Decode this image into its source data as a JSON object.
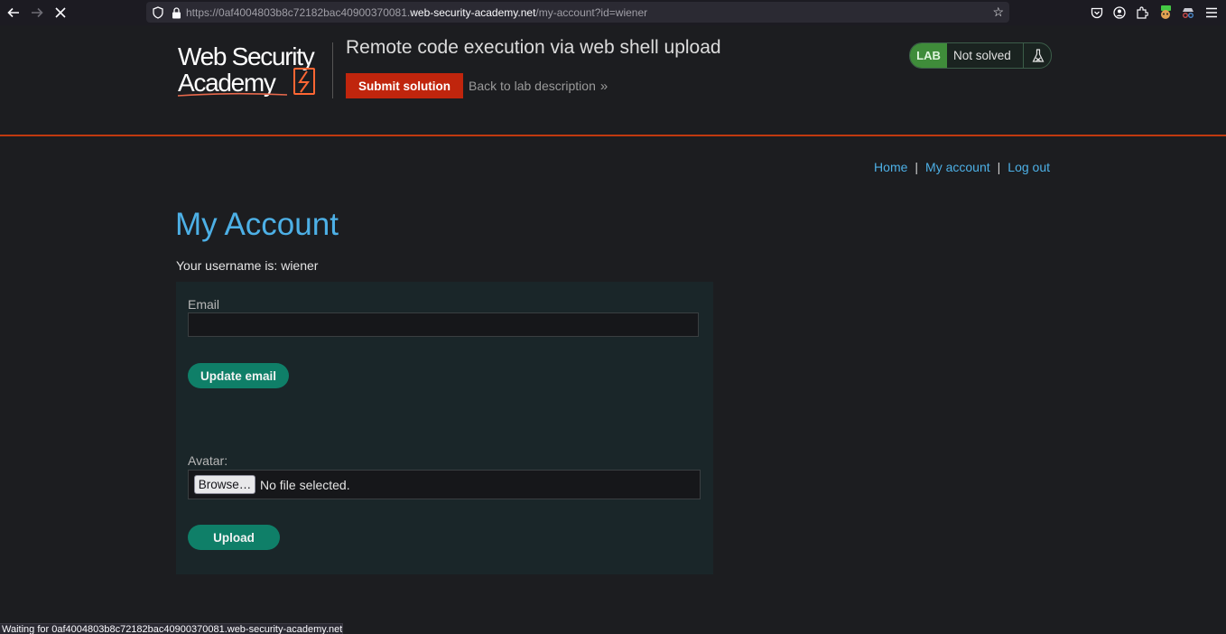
{
  "browser": {
    "url_prefix": "https://0af4004803b8c72182bac40900370081.",
    "url_domain": "web-security-academy.net",
    "url_path": "/my-account?id=wiener",
    "status_text": "Waiting for 0af4004803b8c72182bac40900370081.web-security-academy.net..."
  },
  "lab": {
    "logo_line1": "Web Security",
    "logo_line2": "Academy",
    "title": "Remote code execution via web shell upload",
    "submit_label": "Submit solution",
    "back_label": "Back to lab description",
    "badge": "LAB",
    "status": "Not solved",
    "accent_color": "#c0250d",
    "solved_state_color": "#3f8c3a"
  },
  "nav": {
    "home": "Home",
    "separator": "|",
    "my_account": "My account",
    "log_out": "Log out"
  },
  "page": {
    "heading": "My Account",
    "username_text": "Your username is: wiener",
    "email_label": "Email",
    "email_value": "",
    "update_email_label": "Update email",
    "avatar_label": "Avatar:",
    "browse_label": "Browse…",
    "file_status": "No file selected.",
    "upload_label": "Upload"
  },
  "icons": {
    "back": "arrow-left-icon",
    "forward": "arrow-right-icon",
    "stop": "close-icon",
    "shield": "shield-icon",
    "lock": "lock-icon",
    "bookmark": "star-icon",
    "flask": "flask-icon"
  }
}
